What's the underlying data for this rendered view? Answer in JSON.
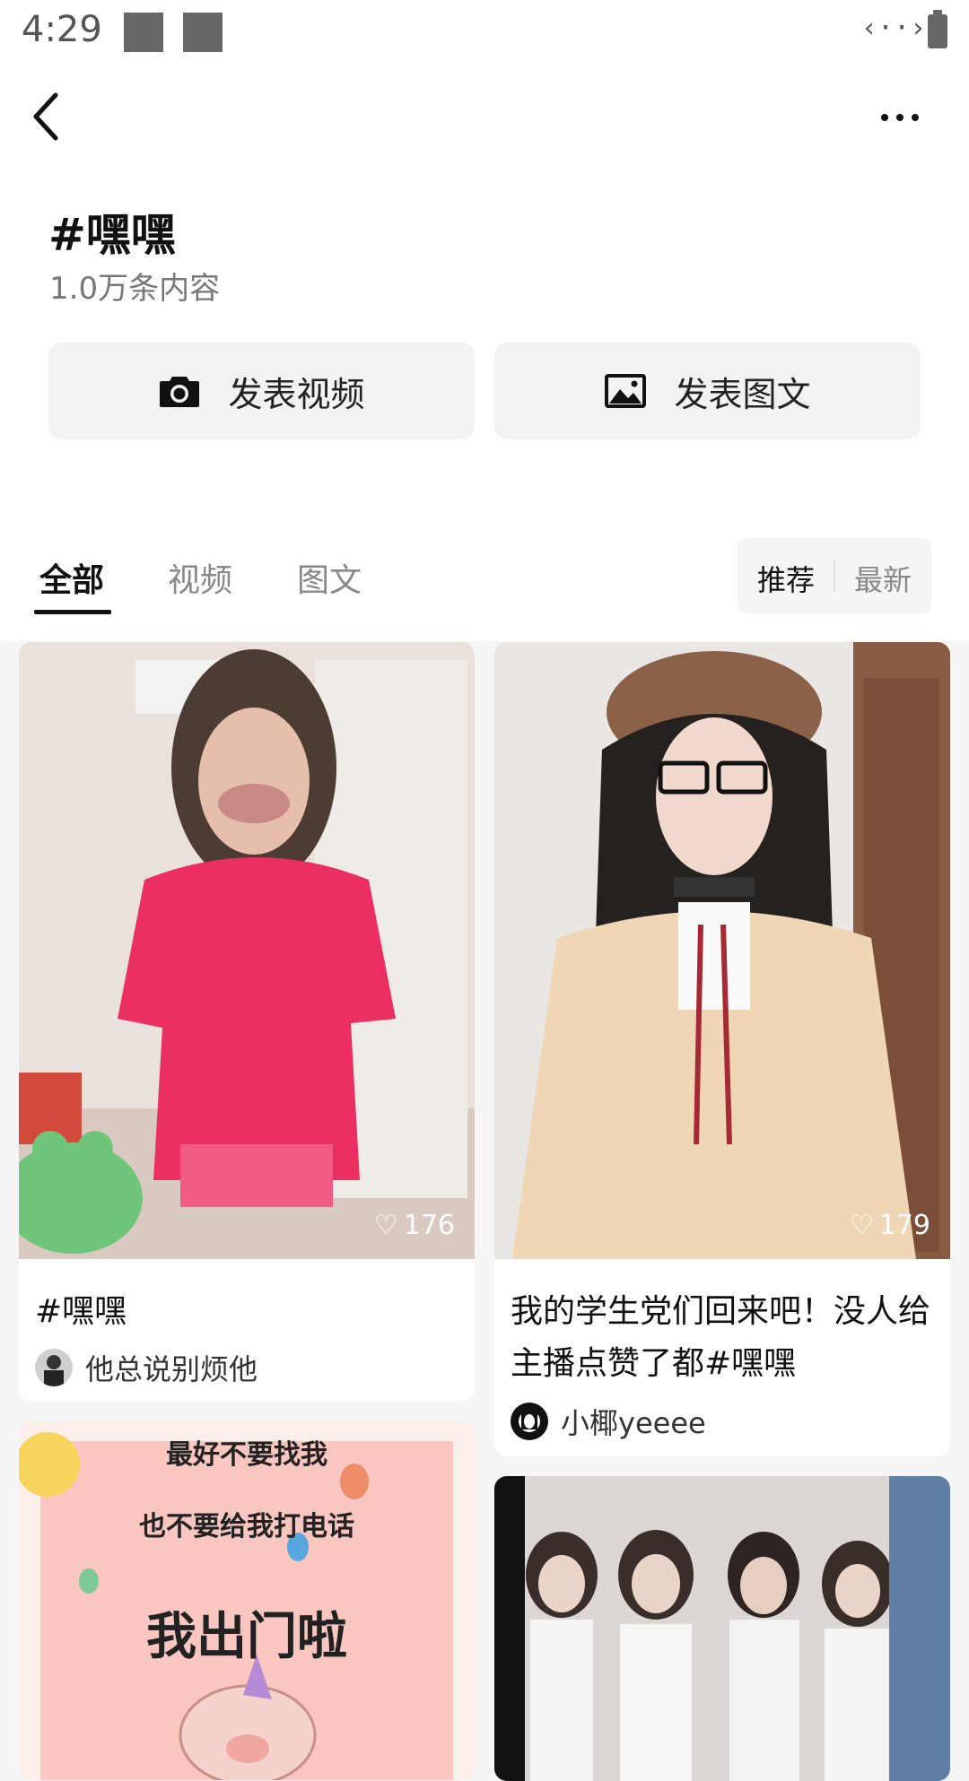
{
  "status_bar": {
    "time": "4:29",
    "network_glyph": "‹··›"
  },
  "topic": {
    "title": "#嘿嘿",
    "count": "1.0万条内容"
  },
  "actions": {
    "publish_video": "发表视频",
    "publish_image": "发表图文"
  },
  "tabs": [
    {
      "label": "全部",
      "active": true
    },
    {
      "label": "视频",
      "active": false
    },
    {
      "label": "图文",
      "active": false
    }
  ],
  "sort": {
    "recommended": "推荐",
    "latest": "最新"
  },
  "feed": [
    {
      "title": "#嘿嘿",
      "author": "他总说别烦他",
      "likes": "176"
    },
    {
      "title": "我的学生党们回来吧！没人给主播点赞了都#嘿嘿",
      "author": "小椰yeeee",
      "likes": "179"
    },
    {
      "poster_lines": [
        "最好不要找我",
        "也不要给我打电话",
        "我出门啦"
      ]
    },
    {}
  ],
  "colors": {
    "accent": "#111111",
    "background": "#f5f5f5",
    "button_bg": "#f2f2f2"
  },
  "icons": [
    "back-arrow-icon",
    "more-dots-icon",
    "camera-icon",
    "image-icon",
    "heart-icon"
  ]
}
